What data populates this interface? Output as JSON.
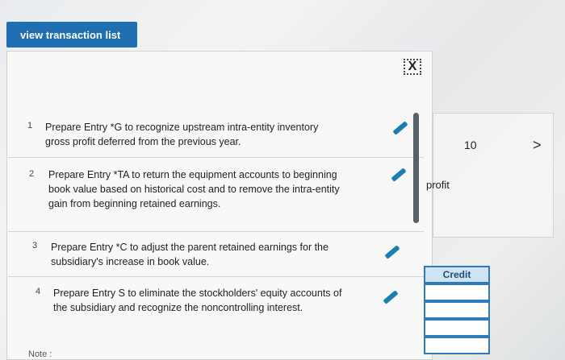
{
  "top_button": "view transaction list",
  "close_icon": "X",
  "items": [
    {
      "num": "1",
      "text": "Prepare Entry *G to recognize upstream intra-entity inventory gross profit deferred from the previous year."
    },
    {
      "num": "2",
      "text": "Prepare Entry *TA to return the equipment accounts to beginning book value based on historical cost and to remove the intra-entity gain from beginning retained earnings."
    },
    {
      "num": "3",
      "text": "Prepare Entry *C to adjust the parent retained earnings for the subsidiary's increase in book value."
    },
    {
      "num": "4",
      "text": "Prepare Entry S to eliminate the stockholders' equity accounts of the subsidiary and recognize the noncontrolling interest."
    }
  ],
  "right": {
    "value": "10",
    "profit_label": "profit",
    "credit_header": "Credit"
  },
  "note": "Note :"
}
